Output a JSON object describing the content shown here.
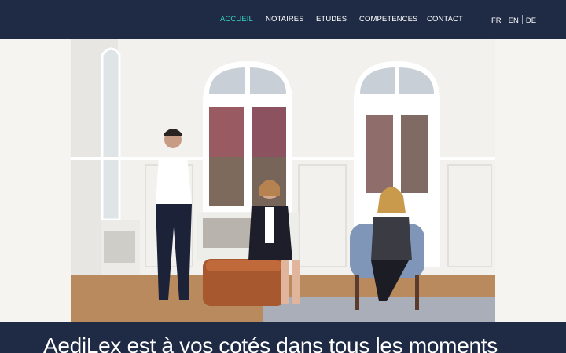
{
  "nav": {
    "items": [
      {
        "label": "ACCUEIL",
        "active": true
      },
      {
        "label": "NOTAIRES",
        "active": false
      },
      {
        "label": "ETUDES",
        "active": false
      },
      {
        "label": "COMPETENCES",
        "active": false
      },
      {
        "label": "CONTACT",
        "active": false
      }
    ],
    "languages": [
      "FR",
      "EN",
      "DE"
    ]
  },
  "hero": {
    "image_description_icon": "team-photo"
  },
  "tagline": "AediLex est à vos cotés dans tous les moments",
  "colors": {
    "header_bg": "#1f2b45",
    "accent": "#34d3c1",
    "text": "#ffffff"
  }
}
